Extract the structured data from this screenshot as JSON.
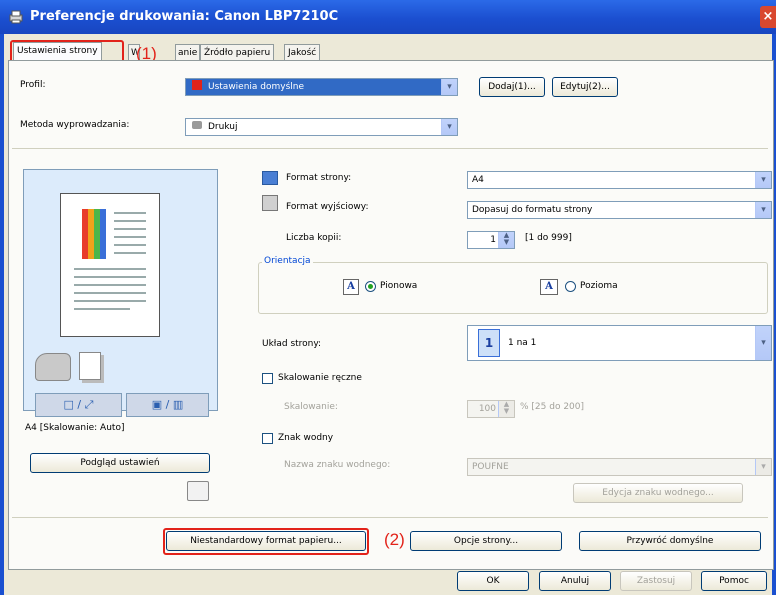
{
  "window": {
    "title": "Preferencje drukowania: Canon LBP7210C",
    "close": "×"
  },
  "tabs": [
    {
      "label": "Ustawienia strony"
    },
    {
      "label": "Wykończenie"
    },
    {
      "label": "Źródło papieru"
    },
    {
      "label": "Jakość"
    }
  ],
  "tab_partial": "anie",
  "tab_partial_left": "W",
  "callouts": {
    "one": "(1)",
    "two": "(2)"
  },
  "profile": {
    "label": "Profil:",
    "value": "Ustawienia domyślne",
    "add_button": "Dodaj(1)...",
    "edit_button": "Edytuj(2)..."
  },
  "output_method": {
    "label": "Metoda wyprowadzania:",
    "value": "Drukuj"
  },
  "preview": {
    "caption": "A4 [Skalowanie: Auto]",
    "preview_settings_button": "Podgląd ustawień"
  },
  "page_format": {
    "label": "Format strony:",
    "value": "A4"
  },
  "output_format": {
    "label": "Format wyjściowy:",
    "value": "Dopasuj do formatu strony"
  },
  "copies": {
    "label": "Liczba kopii:",
    "value": "1",
    "range": "[1 do 999]"
  },
  "orientation": {
    "group": "Orientacja",
    "portrait": "Pionowa",
    "landscape": "Pozioma"
  },
  "layout": {
    "label": "Układ strony:",
    "value": "1 na 1",
    "icon_text": "1"
  },
  "manual_scaling": {
    "label": "Skalowanie ręczne",
    "scale_label": "Skalowanie:",
    "value": "100",
    "range": "% [25 do 200]"
  },
  "watermark": {
    "label": "Znak wodny",
    "name_label": "Nazwa znaku wodnego:",
    "value": "POUFNE",
    "edit_button": "Edycja znaku wodnego..."
  },
  "bottom_row": {
    "custom_paper": "Niestandardowy format papieru...",
    "page_options": "Opcje strony...",
    "restore_defaults": "Przywróć domyślne"
  },
  "dialog_buttons": {
    "ok": "OK",
    "cancel": "Anuluj",
    "apply": "Zastosuj",
    "help": "Pomoc"
  },
  "colors": {
    "titlebar": "#1b4fd0",
    "callout": "#e2231a",
    "selection": "#316ac5"
  }
}
